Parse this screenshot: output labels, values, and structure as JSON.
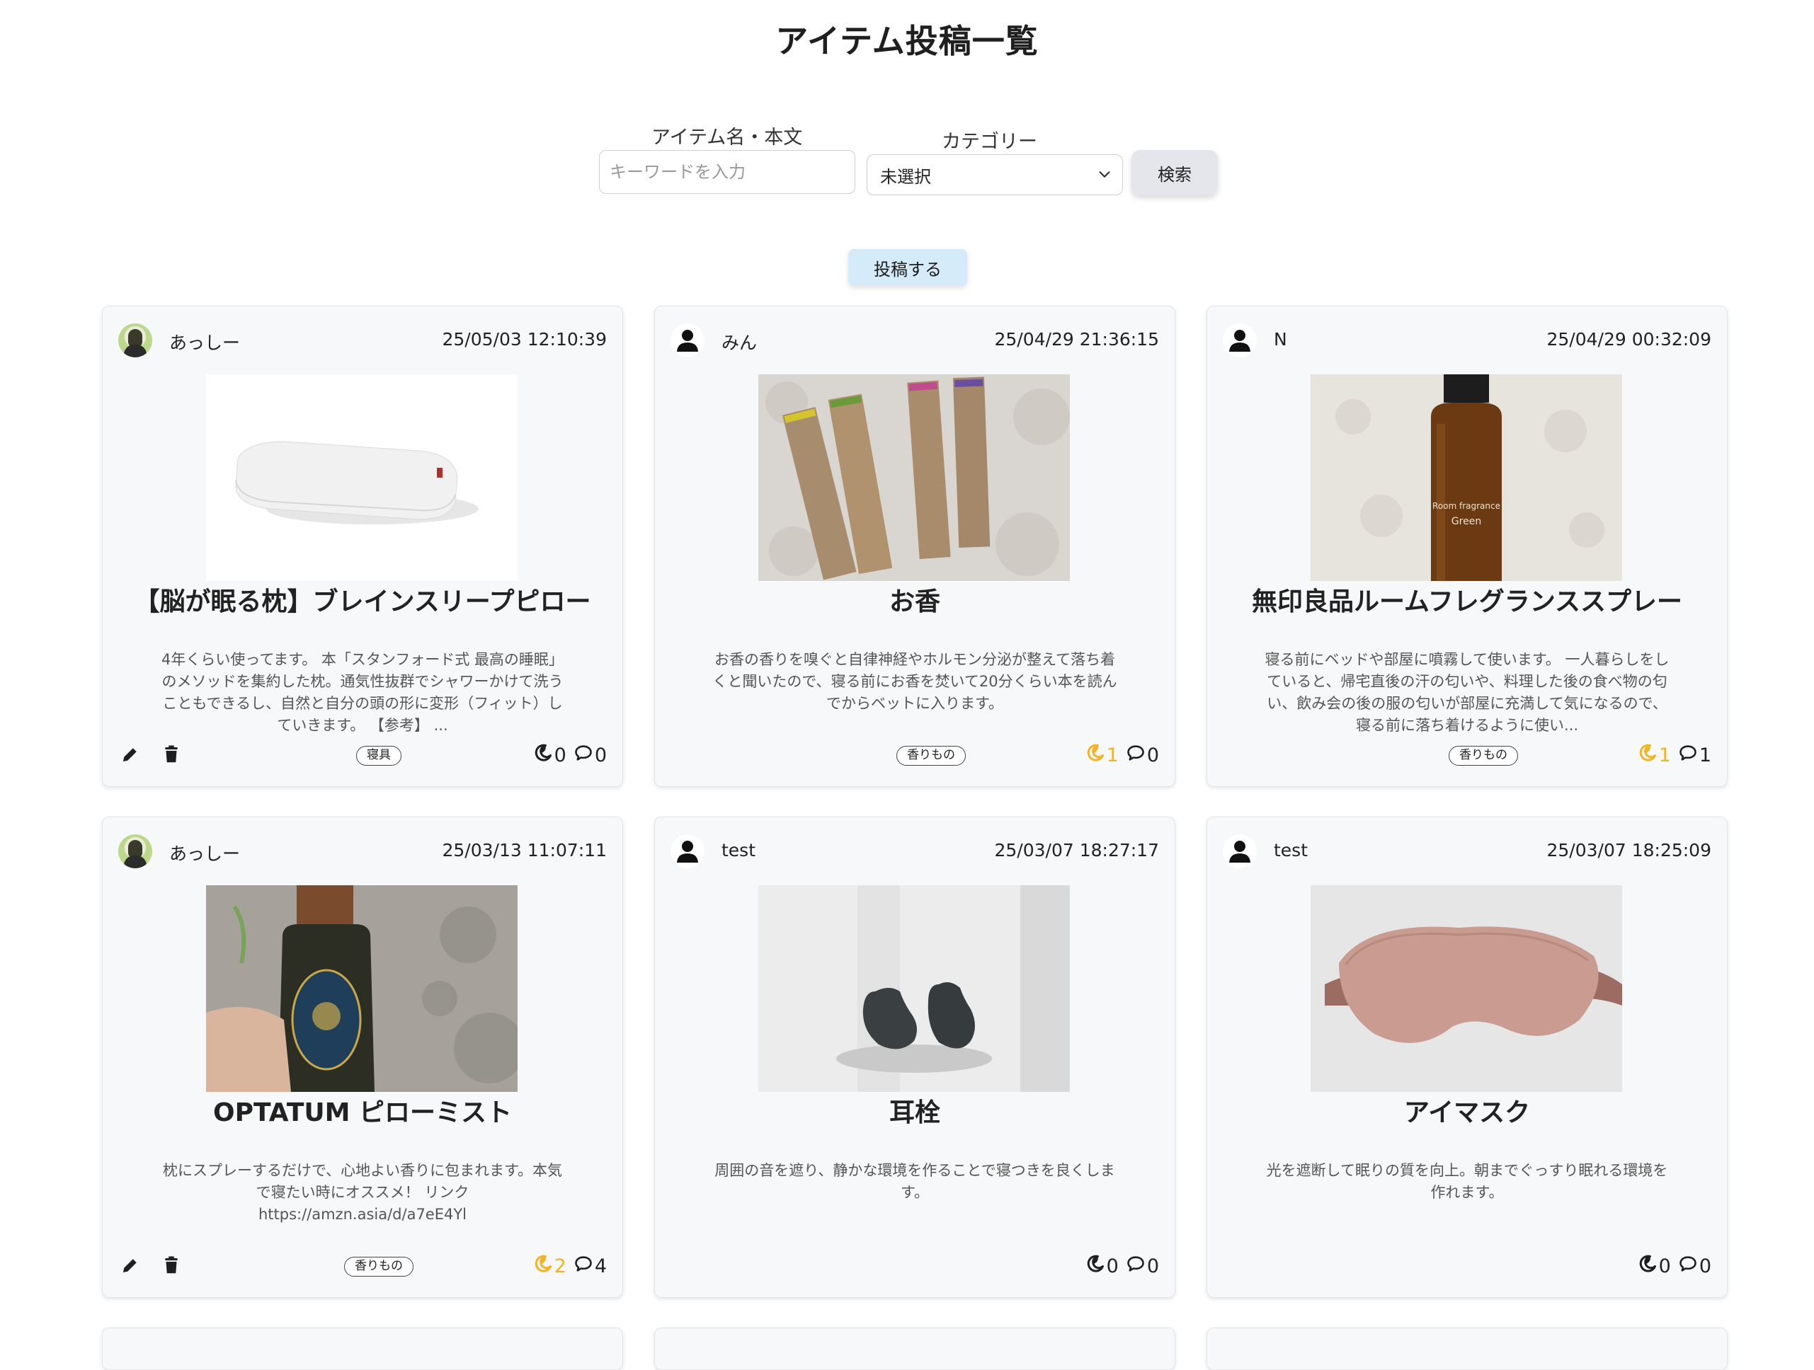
{
  "page": {
    "title": "アイテム投稿一覧"
  },
  "search": {
    "keyword_label": "アイテム名・本文",
    "keyword_placeholder": "キーワードを入力",
    "keyword_value": "",
    "category_label": "カテゴリー",
    "category_value": "未選択",
    "search_button": "検索"
  },
  "post_button": "投稿する",
  "colors": {
    "like_active": "#f0b429",
    "like_inactive": "#1f1f1f",
    "post_button_bg": "#d6ebfa"
  },
  "posts": [
    {
      "user": "あっしー",
      "avatar": "photo",
      "timestamp": "25/05/03 12:10:39",
      "name": "【脳が眠る枕】ブレインスリープピロー",
      "body": "4年くらい使ってます。 本「スタンフォード式 最高の睡眠」のメソッドを集約した枕。通気性抜群でシャワーかけて洗うこともできるし、自然と自分の頭の形に変形（フィット）していきます。 【参考】 ...",
      "category": "寝具",
      "likes": "0",
      "liked": false,
      "comments": "0",
      "owner": true,
      "image": "pillow"
    },
    {
      "user": "みん",
      "avatar": "default",
      "timestamp": "25/04/29 21:36:15",
      "name": "お香",
      "body": "お香の香りを嗅ぐと自律神経やホルモン分泌が整えて落ち着くと聞いたので、寝る前にお香を焚いて20分くらい本を読んでからベットに入ります。",
      "category": "香りもの",
      "likes": "1",
      "liked": true,
      "comments": "0",
      "owner": false,
      "image": "incense"
    },
    {
      "user": "N",
      "avatar": "default",
      "timestamp": "25/04/29 00:32:09",
      "name": "無印良品ルームフレグランススプレー",
      "body": "寝る前にベッドや部屋に噴霧して使います。 一人暮らしをしていると、帰宅直後の汗の匂いや、料理した後の食べ物の匂い、飲み会の後の服の匂いが部屋に充満して気になるので、寝る前に落ち着けるように使い...",
      "category": "香りもの",
      "likes": "1",
      "liked": true,
      "comments": "1",
      "owner": false,
      "image": "spray"
    },
    {
      "user": "あっしー",
      "avatar": "photo",
      "timestamp": "25/03/13 11:07:11",
      "name": "OPTATUM ピローミスト",
      "body": "枕にスプレーするだけで、心地よい香りに包まれます。本気で寝たい時にオススメ！ リンク https://amzn.asia/d/a7eE4Yl",
      "category": "香りもの",
      "likes": "2",
      "liked": true,
      "comments": "4",
      "owner": true,
      "image": "mist"
    },
    {
      "user": "test",
      "avatar": "default",
      "timestamp": "25/03/07 18:27:17",
      "name": "耳栓",
      "body": "周囲の音を遮り、静かな環境を作ることで寝つきを良くします。",
      "category": "",
      "likes": "0",
      "liked": false,
      "comments": "0",
      "owner": false,
      "image": "earplug"
    },
    {
      "user": "test",
      "avatar": "default",
      "timestamp": "25/03/07 18:25:09",
      "name": "アイマスク",
      "body": "光を遮断して眠りの質を向上。朝までぐっすり眠れる環境を作れます。",
      "category": "",
      "likes": "0",
      "liked": false,
      "comments": "0",
      "owner": false,
      "image": "eyemask"
    }
  ]
}
